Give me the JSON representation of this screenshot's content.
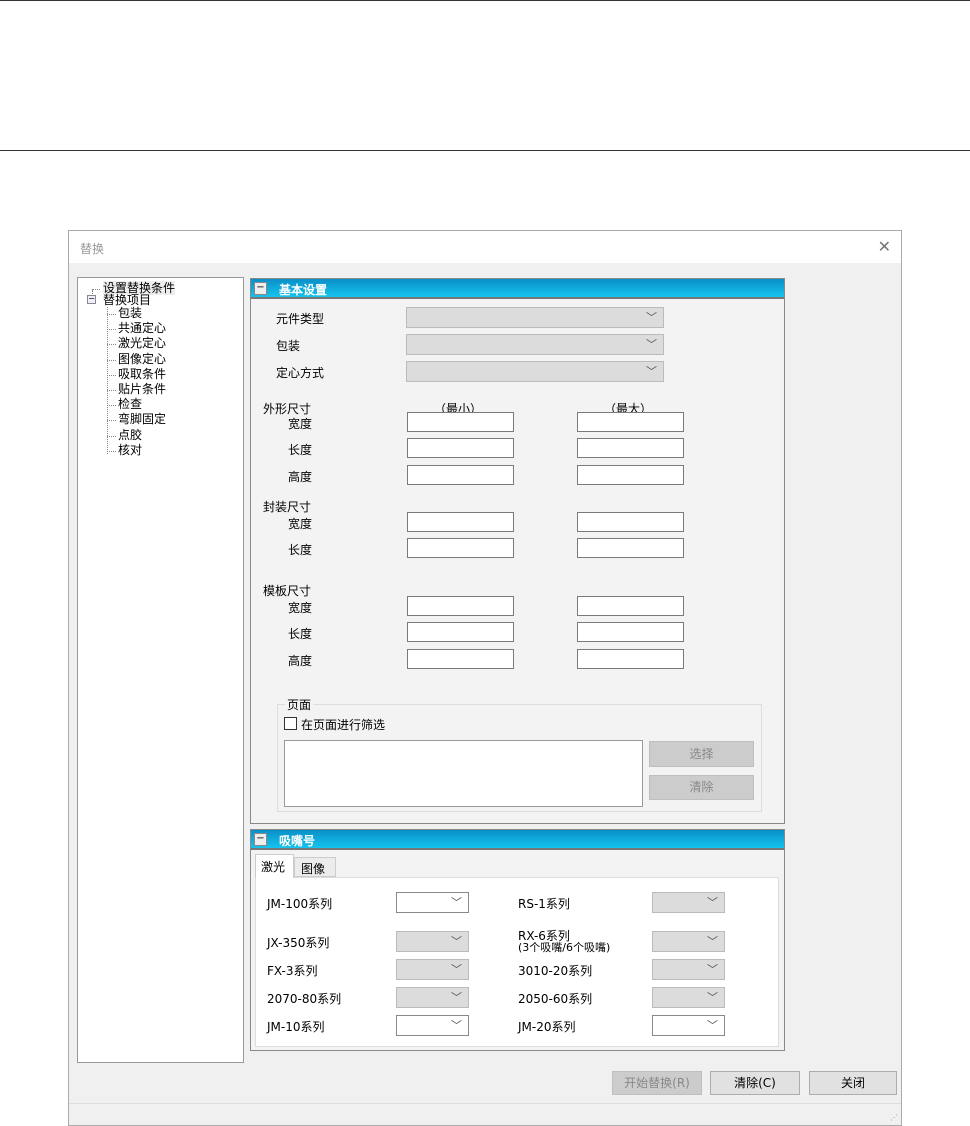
{
  "dialog": {
    "title": "替换",
    "close": "✕"
  },
  "tree": {
    "root": "设置替换条件",
    "group": "替换项目",
    "items": [
      "包装",
      "共通定心",
      "激光定心",
      "图像定心",
      "吸取条件",
      "贴片条件",
      "检查",
      "弯脚固定",
      "点胶",
      "核对"
    ]
  },
  "basic": {
    "title": "基本设置",
    "toggle": "−",
    "component_type": "元件类型",
    "package": "包装",
    "centering": "定心方式",
    "outer_size": "外形尺寸",
    "min": "（最小）",
    "max": "（最大）",
    "width": "宽度",
    "length": "长度",
    "height": "高度",
    "pkg_size": "封装尺寸",
    "tpl_size": "模板尺寸",
    "page_group": "页面",
    "page_filter": "在页面进行筛选",
    "select": "选择",
    "clear": "清除"
  },
  "nozzle": {
    "title": "吸嘴号",
    "toggle": "−",
    "tabs": [
      "激光",
      "图像"
    ],
    "left": [
      {
        "label": "JM-100系列",
        "enabled": true
      },
      {
        "label": "JX-350系列",
        "enabled": false
      },
      {
        "label": "FX-3系列",
        "enabled": false
      },
      {
        "label": "2070-80系列",
        "enabled": false
      },
      {
        "label": "JM-10系列",
        "enabled": true
      }
    ],
    "right": [
      {
        "label": "RS-1系列",
        "enabled": false
      },
      {
        "label": "RX-6系列",
        "sub": "(3个吸嘴/6个吸嘴)",
        "enabled": false
      },
      {
        "label": "3010-20系列",
        "enabled": false
      },
      {
        "label": "2050-60系列",
        "enabled": false
      },
      {
        "label": "JM-20系列",
        "enabled": true
      }
    ]
  },
  "footer": {
    "start": "开始替换(R)",
    "clear": "清除(C)",
    "close": "关闭"
  }
}
